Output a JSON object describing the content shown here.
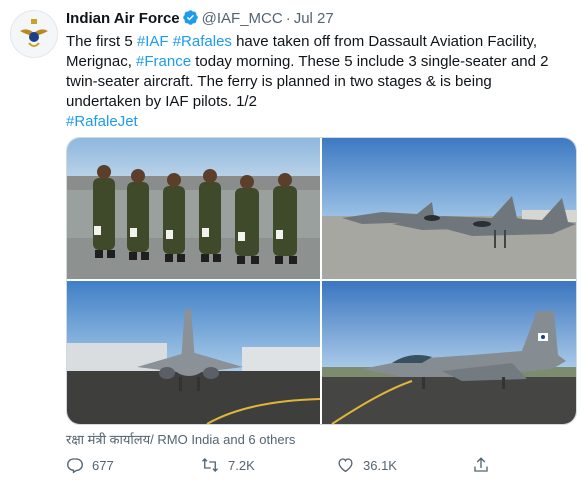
{
  "tweet": {
    "author_name": "Indian Air Force",
    "handle": "@IAF_MCC",
    "separator": "·",
    "date": "Jul 27",
    "verified_icon": "verified-badge-icon",
    "text": {
      "p1": "The first 5 ",
      "tag_iaf": "#IAF",
      "sp1": " ",
      "tag_rafales": "#Rafales",
      "p2": " have taken off from Dassault Aviation Facility, Merignac, ",
      "tag_france": "#France",
      "p3": " today morning. These 5 include 3 single-seater and 2 twin-seater aircraft. The ferry is planned in two stages & is being undertaken by IAF pilots. 1/2",
      "tag_rafalejet": "#RafaleJet"
    },
    "link_color": "#1d9bf0",
    "tagged": "रक्षा मंत्री कार्यालय/ RMO India and 6 others"
  },
  "actions": {
    "reply_count": "677",
    "retweet_count": "7.2K",
    "like_count": "36.1K",
    "icons": [
      "reply-icon",
      "retweet-icon",
      "like-icon",
      "share-icon"
    ]
  },
  "media": {
    "photos": [
      "pilots-group-photo",
      "rafale-row-photo",
      "rafale-front-photo",
      "rafale-side-photo"
    ]
  }
}
